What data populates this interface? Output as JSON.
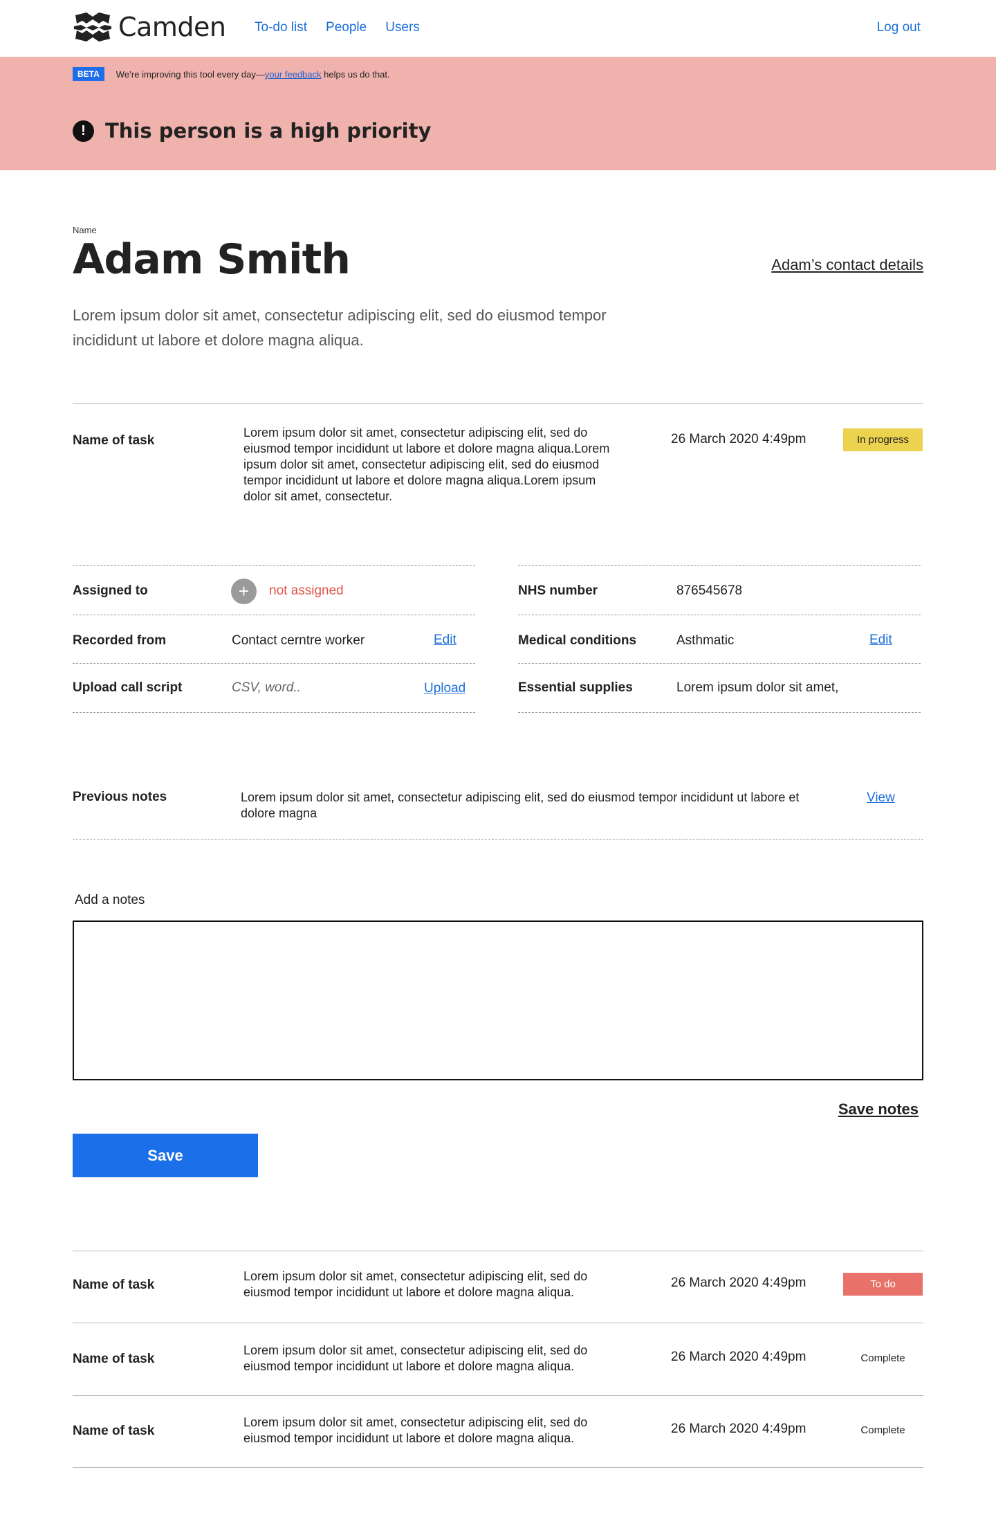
{
  "header": {
    "logo_text": "Camden",
    "nav": [
      "To-do list",
      "People",
      "Users"
    ],
    "logout": "Log out"
  },
  "banner": {
    "beta_tag": "BETA",
    "beta_text_before": "We’re improving this tool every day—",
    "beta_link": "your feedback",
    "beta_text_after": " helps us do that.",
    "priority_icon": "!",
    "priority_text": "This person is a high priority"
  },
  "person": {
    "name_label": "Name",
    "name": "Adam Smith",
    "contact_link": "Adam’s contact details",
    "intro": "Lorem ipsum dolor sit amet, consectetur adipiscing elit, sed do eiusmod tempor incididunt ut labore et dolore magna aliqua."
  },
  "current_task": {
    "name": "Name of task",
    "description": "Lorem ipsum dolor sit amet, consectetur adipiscing elit, sed do eiusmod tempor incididunt ut labore et dolore magna aliqua.Lorem ipsum dolor sit amet, consectetur adipiscing elit, sed do eiusmod tempor incididunt ut labore et dolore magna aliqua.Lorem ipsum dolor sit amet, consectetur.",
    "date": "26 March 2020 4:49pm",
    "status": "In progress"
  },
  "details_left": {
    "assigned_label": "Assigned to",
    "assigned_value": "not assigned",
    "recorded_label": "Recorded from",
    "recorded_value": "Contact cerntre worker",
    "recorded_action": "Edit",
    "upload_label": "Upload call script",
    "upload_placeholder": "CSV, word..",
    "upload_action": "Upload"
  },
  "details_right": {
    "nhs_label": "NHS number",
    "nhs_value": "876545678",
    "medical_label": "Medical conditions",
    "medical_value": "Asthmatic",
    "medical_action": "Edit",
    "supplies_label": "Essential supplies",
    "supplies_value": "Lorem ipsum dolor sit amet,"
  },
  "previous_notes": {
    "label": "Previous notes",
    "text": "Lorem ipsum dolor sit amet, consectetur adipiscing elit, sed do eiusmod tempor incididunt ut labore et dolore magna",
    "action": "View"
  },
  "notes": {
    "label": "Add a notes",
    "value": "",
    "save_notes": "Save notes",
    "save_button": "Save"
  },
  "tasks": [
    {
      "name": "Name of task",
      "description": "Lorem ipsum dolor sit amet, consectetur adipiscing elit, sed do eiusmod tempor incididunt ut labore et dolore magna aliqua.",
      "date": "26 March 2020 4:49pm",
      "status": "To do"
    },
    {
      "name": "Name of task",
      "description": "Lorem ipsum dolor sit amet, consectetur adipiscing elit, sed do eiusmod tempor incididunt ut labore et dolore magna aliqua.",
      "date": "26 March 2020 4:49pm",
      "status": "Complete"
    },
    {
      "name": "Name of task",
      "description": "Lorem ipsum dolor sit amet, consectetur adipiscing elit, sed do eiusmod tempor incididunt ut labore et dolore magna aliqua.",
      "date": "26 March 2020 4:49pm",
      "status": "Complete"
    }
  ],
  "colors": {
    "link": "#1b6fd9",
    "banner": "#f0b2ad",
    "in_progress": "#ecd34f",
    "to_do": "#e8726a",
    "not_assigned": "#e05545",
    "primary_button": "#1b6fe8"
  }
}
